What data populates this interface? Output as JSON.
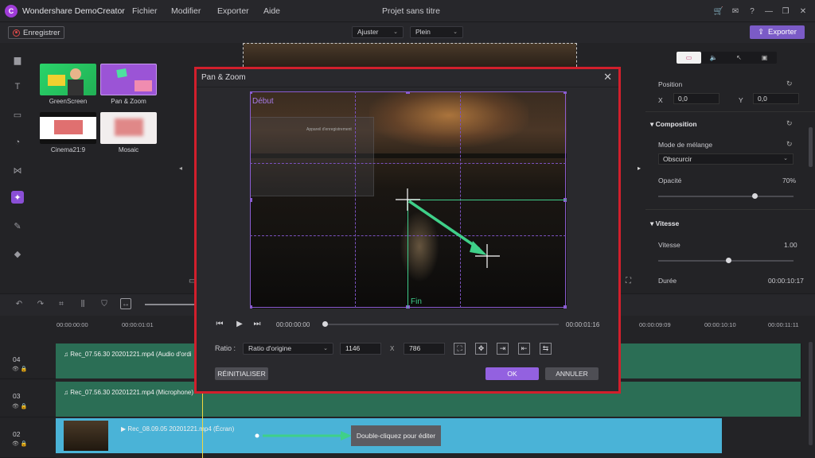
{
  "app": {
    "name": "Wondershare DemoCreator",
    "project_title": "Projet sans titre",
    "logo_glyph": "C"
  },
  "menu": [
    "Fichier",
    "Modifier",
    "Exporter",
    "Aide"
  ],
  "toolbar": {
    "record_label": "Enregistrer",
    "fit_value": "Ajuster",
    "fill_value": "Plein",
    "export_label": "Exporter"
  },
  "effects": [
    {
      "label": "GreenScreen"
    },
    {
      "label": "Pan & Zoom"
    },
    {
      "label": "Cinema21:9"
    },
    {
      "label": "Mosaic"
    }
  ],
  "properties": {
    "tab_icons": [
      "video-icon",
      "audio-icon",
      "cursor-icon",
      "caption-icon"
    ],
    "position_label": "Position",
    "x_label": "X",
    "x_value": "0,0",
    "y_label": "Y",
    "y_value": "0,0",
    "composition_label": "Composition",
    "blend_label": "Mode de mélange",
    "blend_value": "Obscurcir",
    "opacity_label": "Opacité",
    "opacity_value": "70%",
    "opacity_level": 0.7,
    "speed_section": "Vitesse",
    "speed_label": "Vitesse",
    "speed_value": "1.00",
    "duration_label": "Durée",
    "duration_value": "00:00:10:17"
  },
  "ruler": [
    "00:00:00:00",
    "00:00:01:01",
    "00:00:09:09",
    "00:00:10:10",
    "00:00:11:11"
  ],
  "tracks": [
    {
      "num": "04",
      "clip": "Rec_07.56.30 20201221.mp4 (Audio d'ordi"
    },
    {
      "num": "03",
      "clip": "Rec_07.56.30 20201221.mp4 (Microphone)"
    },
    {
      "num": "02",
      "clip": "Rec_08.09.05 20201221.mp4 (Écran)"
    }
  ],
  "tooltip": "Double-cliquez pour éditer",
  "dialog": {
    "title": "Pan & Zoom",
    "start_label": "Début",
    "end_label": "Fin",
    "time_start": "00:00:00:00",
    "time_end": "00:00:01:16",
    "ratio_label": "Ratio :",
    "ratio_value": "Ratio d'origine",
    "width": "1146",
    "x_sep": "X",
    "height": "786",
    "reset_label": "RÉINITIALISER",
    "ok_label": "OK",
    "cancel_label": "ANNULER",
    "ghost_title": "Appareil d'enregistrement"
  },
  "colors": {
    "accent": "#8a4fd6",
    "highlight_border": "#d21f2c",
    "end_green": "#3ecc8a",
    "clip_blue": "#4ab3d7",
    "clip_green": "#2b6e55"
  }
}
